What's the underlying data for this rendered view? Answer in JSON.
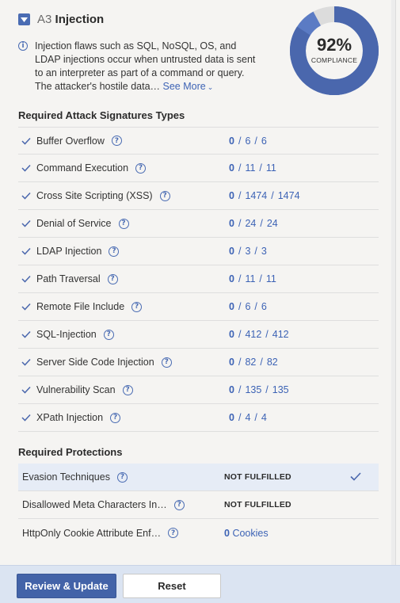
{
  "header": {
    "code": "A3",
    "name": "Injection",
    "description": "Injection flaws such as SQL, NoSQL, OS, and LDAP injections occur when untrusted data is sent to an interpreter as part of a command or query. The attacker's hostile data…",
    "see_more": "See More"
  },
  "compliance": {
    "percent_label": "92%",
    "label": "COMPLIANCE",
    "value": 0.92,
    "colors": {
      "main": "#4a67ad",
      "secondary": "#5b7bc4",
      "remainder": "#dcdcdc"
    }
  },
  "signatures": {
    "title": "Required Attack Signatures Types",
    "items": [
      {
        "name": "Buffer Overflow",
        "a": "0",
        "b": "6",
        "c": "6"
      },
      {
        "name": "Command Execution",
        "a": "0",
        "b": "11",
        "c": "11"
      },
      {
        "name": "Cross Site Scripting (XSS)",
        "a": "0",
        "b": "1474",
        "c": "1474"
      },
      {
        "name": "Denial of Service",
        "a": "0",
        "b": "24",
        "c": "24"
      },
      {
        "name": "LDAP Injection",
        "a": "0",
        "b": "3",
        "c": "3"
      },
      {
        "name": "Path Traversal",
        "a": "0",
        "b": "11",
        "c": "11"
      },
      {
        "name": "Remote File Include",
        "a": "0",
        "b": "6",
        "c": "6"
      },
      {
        "name": "SQL-Injection",
        "a": "0",
        "b": "412",
        "c": "412"
      },
      {
        "name": "Server Side Code Injection",
        "a": "0",
        "b": "82",
        "c": "82"
      },
      {
        "name": "Vulnerability Scan",
        "a": "0",
        "b": "135",
        "c": "135"
      },
      {
        "name": "XPath Injection",
        "a": "0",
        "b": "4",
        "c": "4"
      }
    ]
  },
  "protections": {
    "title": "Required Protections",
    "items": [
      {
        "name": "Evasion Techniques",
        "status": "NOT FULFILLED"
      },
      {
        "name": "Disallowed Meta Characters In…",
        "status": "NOT FULFILLED"
      },
      {
        "name": "HttpOnly Cookie Attribute Enf…",
        "count": "0",
        "unit": "Cookies"
      }
    ]
  },
  "footer": {
    "review_label": "Review & Update",
    "reset_label": "Reset"
  }
}
